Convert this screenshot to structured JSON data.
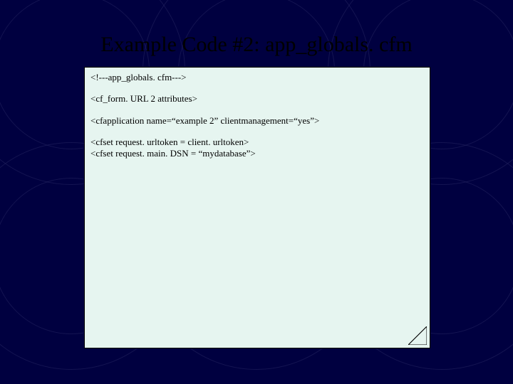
{
  "title": "Example Code #2: app_globals. cfm",
  "code": {
    "line1": "<!---app_globals. cfm--->",
    "line2": "<cf_form. URL 2 attributes>",
    "line3": "<cfapplication name=“example 2” clientmanagement=“yes”>",
    "line4": "<cfset request. urltoken = client. urltoken>",
    "line5": "<cfset request. main. DSN = “mydatabase”>"
  }
}
